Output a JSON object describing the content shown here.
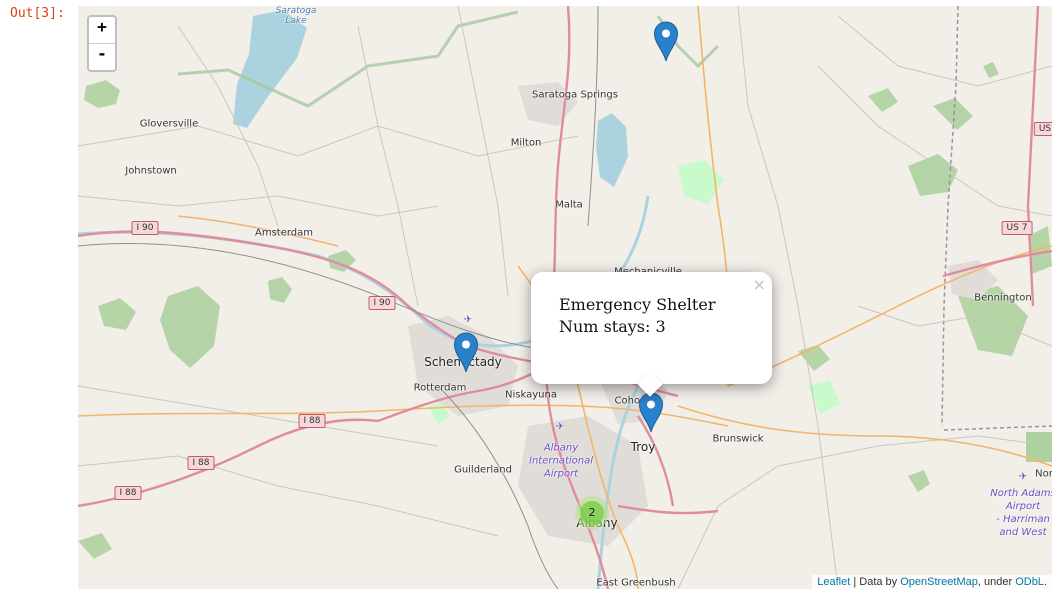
{
  "output_prompt": "Out[3]:",
  "zoom": {
    "in_label": "+",
    "out_label": "-"
  },
  "popup": {
    "title": "Emergency Shelter",
    "stays": "Num stays: 3",
    "close_label": "×"
  },
  "cluster": {
    "count": "2",
    "color": "#6ecc39"
  },
  "marker_color": "#2a81cb",
  "labels": {
    "saratoga_lake": "Saratoga\nLake",
    "saratoga_springs": "Saratoga Springs",
    "gloversville": "Gloversville",
    "johnstown": "Johnstown",
    "milton": "Milton",
    "malta": "Malta",
    "amsterdam": "Amsterdam",
    "schenectady": "Schenectady",
    "rotterdam": "Rotterdam",
    "niskayuna": "Niskayuna",
    "cohoes": "Cohoes",
    "troy": "Troy",
    "brunswick": "Brunswick",
    "guilderland": "Guilderland",
    "albany": "Albany",
    "east_greenbush": "East Greenbush",
    "bennington": "Bennington",
    "mechanicville": "Mechanicville",
    "north": "Nor",
    "albany_airport": "Albany\nInternational\nAirport",
    "north_adams_airport": "North Adams\nAirport\n- Harriman\nand West"
  },
  "shields": {
    "i90_a": "I 90",
    "i90_b": "I 90",
    "i88_a": "I 88",
    "i88_b": "I 88",
    "i88_c": "I 88",
    "us7": "US 7",
    "us": "US"
  },
  "attribution": {
    "leaflet": "Leaflet",
    "sep1": " | Data by ",
    "osm": "OpenStreetMap",
    "sep2": ", under ",
    "odbl": "ODbL",
    "end": "."
  }
}
